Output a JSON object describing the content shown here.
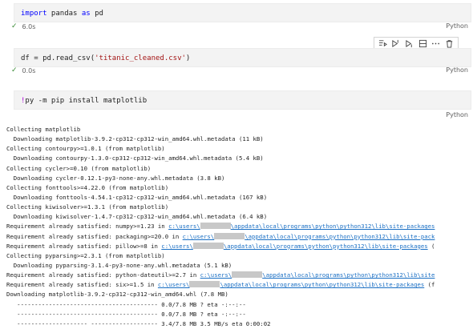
{
  "cells": [
    {
      "code_tokens": [
        {
          "t": "import",
          "c": "kw"
        },
        {
          "t": " pandas ",
          "c": ""
        },
        {
          "t": "as",
          "c": "kw"
        },
        {
          "t": " pd",
          "c": ""
        }
      ],
      "time": "6.0s",
      "lang": "Python"
    },
    {
      "code_tokens": [
        {
          "t": "df = pd.read_csv(",
          "c": ""
        },
        {
          "t": "'titanic_cleaned.csv'",
          "c": "str"
        },
        {
          "t": ")",
          "c": ""
        }
      ],
      "time": "0.0s",
      "lang": "Python"
    },
    {
      "code_tokens": [
        {
          "t": "!",
          "c": "bang"
        },
        {
          "t": "py -m pip install matplotlib",
          "c": ""
        }
      ],
      "time": "",
      "lang": "Python"
    }
  ],
  "toolbar_icons": [
    "run-by-line-icon",
    "execute-above-icon",
    "execute-below-icon",
    "split-cell-icon",
    "more-icon",
    "delete-icon"
  ],
  "output_lines": [
    {
      "parts": [
        {
          "t": "Collecting matplotlib"
        }
      ]
    },
    {
      "parts": [
        {
          "t": "  Downloading matplotlib-3.9.2-cp312-cp312-win_amd64.whl.metadata (11 kB)"
        }
      ]
    },
    {
      "parts": [
        {
          "t": "Collecting contourpy>=1.0.1 (from matplotlib)"
        }
      ]
    },
    {
      "parts": [
        {
          "t": "  Downloading contourpy-1.3.0-cp312-cp312-win_amd64.whl.metadata (5.4 kB)"
        }
      ]
    },
    {
      "parts": [
        {
          "t": "Collecting cycler>=0.10 (from matplotlib)"
        }
      ]
    },
    {
      "parts": [
        {
          "t": "  Downloading cycler-0.12.1-py3-none-any.whl.metadata (3.8 kB)"
        }
      ]
    },
    {
      "parts": [
        {
          "t": "Collecting fonttools>=4.22.0 (from matplotlib)"
        }
      ]
    },
    {
      "parts": [
        {
          "t": "  Downloading fonttools-4.54.1-cp312-cp312-win_amd64.whl.metadata (167 kB)"
        }
      ]
    },
    {
      "parts": [
        {
          "t": "Collecting kiwisolver>=1.3.1 (from matplotlib)"
        }
      ]
    },
    {
      "parts": [
        {
          "t": "  Downloading kiwisolver-1.4.7-cp312-cp312-win_amd64.whl.metadata (6.4 kB)"
        }
      ]
    },
    {
      "parts": [
        {
          "t": "Requirement already satisfied: numpy>=1.23 in "
        },
        {
          "t": "c:\\users\\",
          "link": true
        },
        {
          "t": "",
          "redact": true
        },
        {
          "t": "\\appdata\\local\\programs\\python\\python312\\lib\\site-packages",
          "link": true
        }
      ]
    },
    {
      "parts": [
        {
          "t": "Requirement already satisfied: packaging>=20.0 in "
        },
        {
          "t": "c:\\users\\",
          "link": true
        },
        {
          "t": "",
          "redact": true
        },
        {
          "t": "\\appdata\\local\\programs\\python\\python312\\lib\\site-pack",
          "link": true
        }
      ]
    },
    {
      "parts": [
        {
          "t": "Requirement already satisfied: pillow>=8 in "
        },
        {
          "t": "c:\\users\\",
          "link": true
        },
        {
          "t": "",
          "redact": true
        },
        {
          "t": "\\appdata\\local\\programs\\python\\python312\\lib\\site-packages",
          "link": true
        },
        {
          "t": " ("
        }
      ]
    },
    {
      "parts": [
        {
          "t": "Collecting pyparsing>=2.3.1 (from matplotlib)"
        }
      ]
    },
    {
      "parts": [
        {
          "t": "  Downloading pyparsing-3.1.4-py3-none-any.whl.metadata (5.1 kB)"
        }
      ]
    },
    {
      "parts": [
        {
          "t": "Requirement already satisfied: python-dateutil>=2.7 in "
        },
        {
          "t": "c:\\users\\",
          "link": true
        },
        {
          "t": "",
          "redact": true
        },
        {
          "t": "\\appdata\\local\\programs\\python\\python312\\lib\\site",
          "link": true
        }
      ]
    },
    {
      "parts": [
        {
          "t": "Requirement already satisfied: six>=1.5 in "
        },
        {
          "t": "c:\\users\\",
          "link": true
        },
        {
          "t": "",
          "redact": true
        },
        {
          "t": "\\appdata\\local\\programs\\python\\python312\\lib\\site-packages",
          "link": true
        },
        {
          "t": " (f"
        }
      ]
    },
    {
      "parts": [
        {
          "t": "Downloading matplotlib-3.9.2-cp312-cp312-win_amd64.whl (7.8 MB)"
        }
      ]
    },
    {
      "parts": [
        {
          "t": "   ---------------------------------------- 0.0/7.8 MB ? eta -:--:--"
        }
      ]
    },
    {
      "parts": [
        {
          "t": "   ---------------------------------------- 0.0/7.8 MB ? eta -:--:--"
        }
      ]
    },
    {
      "parts": [
        {
          "t": "   -------------------- ------------------- 3.4/7.8 MB 3.5 MB/s eta 0:00:02"
        }
      ]
    }
  ]
}
